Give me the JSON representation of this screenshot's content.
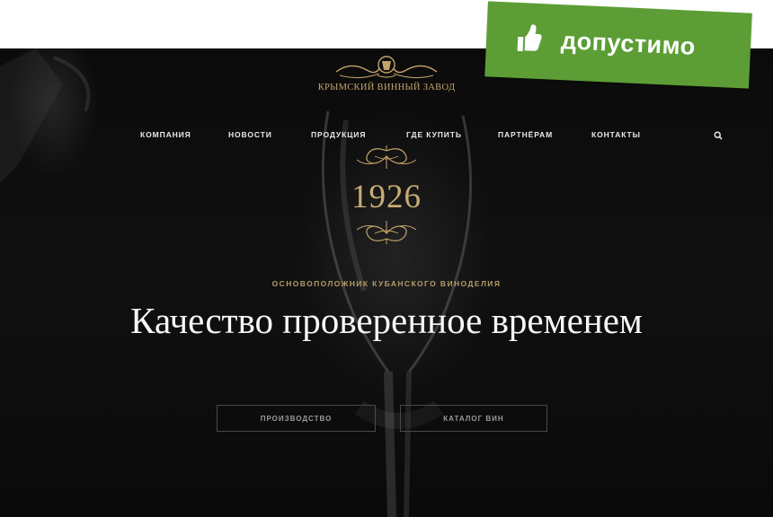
{
  "brand": {
    "name": "КРЫМСКИЙ ВИННЫЙ ЗАВОД",
    "accent_color": "#c4a46b"
  },
  "nav": {
    "items": [
      {
        "label": "КОМПАНИЯ"
      },
      {
        "label": "НОВОСТИ"
      },
      {
        "label": "ПРОДУКЦИЯ"
      },
      {
        "label": "ГДЕ КУПИТЬ"
      },
      {
        "label": "ПАРТНЁРАМ"
      },
      {
        "label": "КОНТАКТЫ"
      }
    ],
    "search_icon": "search-icon"
  },
  "hero": {
    "year": "1926",
    "subtitle": "ОСНОВОПОЛОЖНИК КУБАНСКОГО ВИНОДЕЛИЯ",
    "headline": "Качество проверенное временем",
    "buttons": [
      {
        "label": "ПРОИЗВОДСТВО"
      },
      {
        "label": "КАТАЛОГ ВИН"
      }
    ]
  },
  "badge": {
    "label": "допустимо",
    "icon": "thumbs-up-icon",
    "color": "#5c9e35"
  }
}
